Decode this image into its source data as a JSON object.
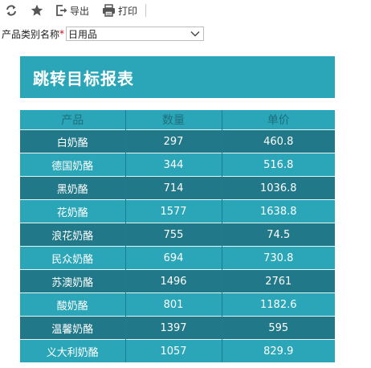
{
  "toolbar": {
    "export_label": "导出",
    "print_label": "打印",
    "icons": [
      "refresh-icon",
      "star-icon",
      "export-icon",
      "print-icon"
    ]
  },
  "filter": {
    "label": "产品类别名称",
    "required_mark": "*",
    "selected": "日用品"
  },
  "report": {
    "title": "跳转目标报表",
    "columns": [
      "产品",
      "数量",
      "单价"
    ],
    "rows": [
      [
        "白奶酪",
        "297",
        "460.8"
      ],
      [
        "德国奶酪",
        "344",
        "516.8"
      ],
      [
        "黑奶酪",
        "714",
        "1036.8"
      ],
      [
        "花奶酪",
        "1577",
        "1638.8"
      ],
      [
        "浪花奶酪",
        "755",
        "74.5"
      ],
      [
        "民众奶酪",
        "694",
        "730.8"
      ],
      [
        "苏澳奶酪",
        "1496",
        "2761"
      ],
      [
        "酸奶酪",
        "801",
        "1182.6"
      ],
      [
        "温馨奶酪",
        "1397",
        "595"
      ],
      [
        "义大利奶酪",
        "1057",
        "829.9"
      ]
    ]
  },
  "colors": {
    "header_teal": "#2aa6b8",
    "row_dark": "#217888",
    "row_light": "#2aa6b8",
    "required": "#d0021b"
  }
}
